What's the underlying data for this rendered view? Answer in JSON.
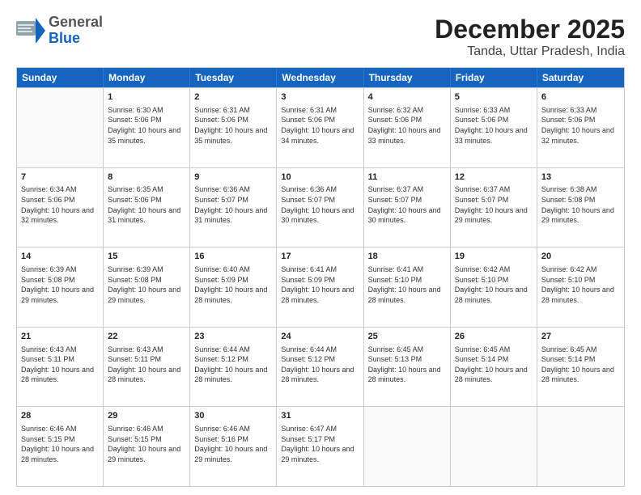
{
  "logo": {
    "general": "General",
    "blue": "Blue"
  },
  "title": "December 2025",
  "location": "Tanda, Uttar Pradesh, India",
  "days": [
    "Sunday",
    "Monday",
    "Tuesday",
    "Wednesday",
    "Thursday",
    "Friday",
    "Saturday"
  ],
  "rows": [
    [
      {
        "day": "",
        "sunrise": "",
        "sunset": "",
        "daylight": "",
        "empty": true
      },
      {
        "day": "1",
        "sunrise": "Sunrise: 6:30 AM",
        "sunset": "Sunset: 5:06 PM",
        "daylight": "Daylight: 10 hours and 35 minutes."
      },
      {
        "day": "2",
        "sunrise": "Sunrise: 6:31 AM",
        "sunset": "Sunset: 5:06 PM",
        "daylight": "Daylight: 10 hours and 35 minutes."
      },
      {
        "day": "3",
        "sunrise": "Sunrise: 6:31 AM",
        "sunset": "Sunset: 5:06 PM",
        "daylight": "Daylight: 10 hours and 34 minutes."
      },
      {
        "day": "4",
        "sunrise": "Sunrise: 6:32 AM",
        "sunset": "Sunset: 5:06 PM",
        "daylight": "Daylight: 10 hours and 33 minutes."
      },
      {
        "day": "5",
        "sunrise": "Sunrise: 6:33 AM",
        "sunset": "Sunset: 5:06 PM",
        "daylight": "Daylight: 10 hours and 33 minutes."
      },
      {
        "day": "6",
        "sunrise": "Sunrise: 6:33 AM",
        "sunset": "Sunset: 5:06 PM",
        "daylight": "Daylight: 10 hours and 32 minutes."
      }
    ],
    [
      {
        "day": "7",
        "sunrise": "Sunrise: 6:34 AM",
        "sunset": "Sunset: 5:06 PM",
        "daylight": "Daylight: 10 hours and 32 minutes."
      },
      {
        "day": "8",
        "sunrise": "Sunrise: 6:35 AM",
        "sunset": "Sunset: 5:06 PM",
        "daylight": "Daylight: 10 hours and 31 minutes."
      },
      {
        "day": "9",
        "sunrise": "Sunrise: 6:36 AM",
        "sunset": "Sunset: 5:07 PM",
        "daylight": "Daylight: 10 hours and 31 minutes."
      },
      {
        "day": "10",
        "sunrise": "Sunrise: 6:36 AM",
        "sunset": "Sunset: 5:07 PM",
        "daylight": "Daylight: 10 hours and 30 minutes."
      },
      {
        "day": "11",
        "sunrise": "Sunrise: 6:37 AM",
        "sunset": "Sunset: 5:07 PM",
        "daylight": "Daylight: 10 hours and 30 minutes."
      },
      {
        "day": "12",
        "sunrise": "Sunrise: 6:37 AM",
        "sunset": "Sunset: 5:07 PM",
        "daylight": "Daylight: 10 hours and 29 minutes."
      },
      {
        "day": "13",
        "sunrise": "Sunrise: 6:38 AM",
        "sunset": "Sunset: 5:08 PM",
        "daylight": "Daylight: 10 hours and 29 minutes."
      }
    ],
    [
      {
        "day": "14",
        "sunrise": "Sunrise: 6:39 AM",
        "sunset": "Sunset: 5:08 PM",
        "daylight": "Daylight: 10 hours and 29 minutes."
      },
      {
        "day": "15",
        "sunrise": "Sunrise: 6:39 AM",
        "sunset": "Sunset: 5:08 PM",
        "daylight": "Daylight: 10 hours and 29 minutes."
      },
      {
        "day": "16",
        "sunrise": "Sunrise: 6:40 AM",
        "sunset": "Sunset: 5:09 PM",
        "daylight": "Daylight: 10 hours and 28 minutes."
      },
      {
        "day": "17",
        "sunrise": "Sunrise: 6:41 AM",
        "sunset": "Sunset: 5:09 PM",
        "daylight": "Daylight: 10 hours and 28 minutes."
      },
      {
        "day": "18",
        "sunrise": "Sunrise: 6:41 AM",
        "sunset": "Sunset: 5:10 PM",
        "daylight": "Daylight: 10 hours and 28 minutes."
      },
      {
        "day": "19",
        "sunrise": "Sunrise: 6:42 AM",
        "sunset": "Sunset: 5:10 PM",
        "daylight": "Daylight: 10 hours and 28 minutes."
      },
      {
        "day": "20",
        "sunrise": "Sunrise: 6:42 AM",
        "sunset": "Sunset: 5:10 PM",
        "daylight": "Daylight: 10 hours and 28 minutes."
      }
    ],
    [
      {
        "day": "21",
        "sunrise": "Sunrise: 6:43 AM",
        "sunset": "Sunset: 5:11 PM",
        "daylight": "Daylight: 10 hours and 28 minutes."
      },
      {
        "day": "22",
        "sunrise": "Sunrise: 6:43 AM",
        "sunset": "Sunset: 5:11 PM",
        "daylight": "Daylight: 10 hours and 28 minutes."
      },
      {
        "day": "23",
        "sunrise": "Sunrise: 6:44 AM",
        "sunset": "Sunset: 5:12 PM",
        "daylight": "Daylight: 10 hours and 28 minutes."
      },
      {
        "day": "24",
        "sunrise": "Sunrise: 6:44 AM",
        "sunset": "Sunset: 5:12 PM",
        "daylight": "Daylight: 10 hours and 28 minutes."
      },
      {
        "day": "25",
        "sunrise": "Sunrise: 6:45 AM",
        "sunset": "Sunset: 5:13 PM",
        "daylight": "Daylight: 10 hours and 28 minutes."
      },
      {
        "day": "26",
        "sunrise": "Sunrise: 6:45 AM",
        "sunset": "Sunset: 5:14 PM",
        "daylight": "Daylight: 10 hours and 28 minutes."
      },
      {
        "day": "27",
        "sunrise": "Sunrise: 6:45 AM",
        "sunset": "Sunset: 5:14 PM",
        "daylight": "Daylight: 10 hours and 28 minutes."
      }
    ],
    [
      {
        "day": "28",
        "sunrise": "Sunrise: 6:46 AM",
        "sunset": "Sunset: 5:15 PM",
        "daylight": "Daylight: 10 hours and 28 minutes."
      },
      {
        "day": "29",
        "sunrise": "Sunrise: 6:46 AM",
        "sunset": "Sunset: 5:15 PM",
        "daylight": "Daylight: 10 hours and 29 minutes."
      },
      {
        "day": "30",
        "sunrise": "Sunrise: 6:46 AM",
        "sunset": "Sunset: 5:16 PM",
        "daylight": "Daylight: 10 hours and 29 minutes."
      },
      {
        "day": "31",
        "sunrise": "Sunrise: 6:47 AM",
        "sunset": "Sunset: 5:17 PM",
        "daylight": "Daylight: 10 hours and 29 minutes."
      },
      {
        "day": "",
        "sunrise": "",
        "sunset": "",
        "daylight": "",
        "empty": true
      },
      {
        "day": "",
        "sunrise": "",
        "sunset": "",
        "daylight": "",
        "empty": true
      },
      {
        "day": "",
        "sunrise": "",
        "sunset": "",
        "daylight": "",
        "empty": true
      }
    ]
  ]
}
